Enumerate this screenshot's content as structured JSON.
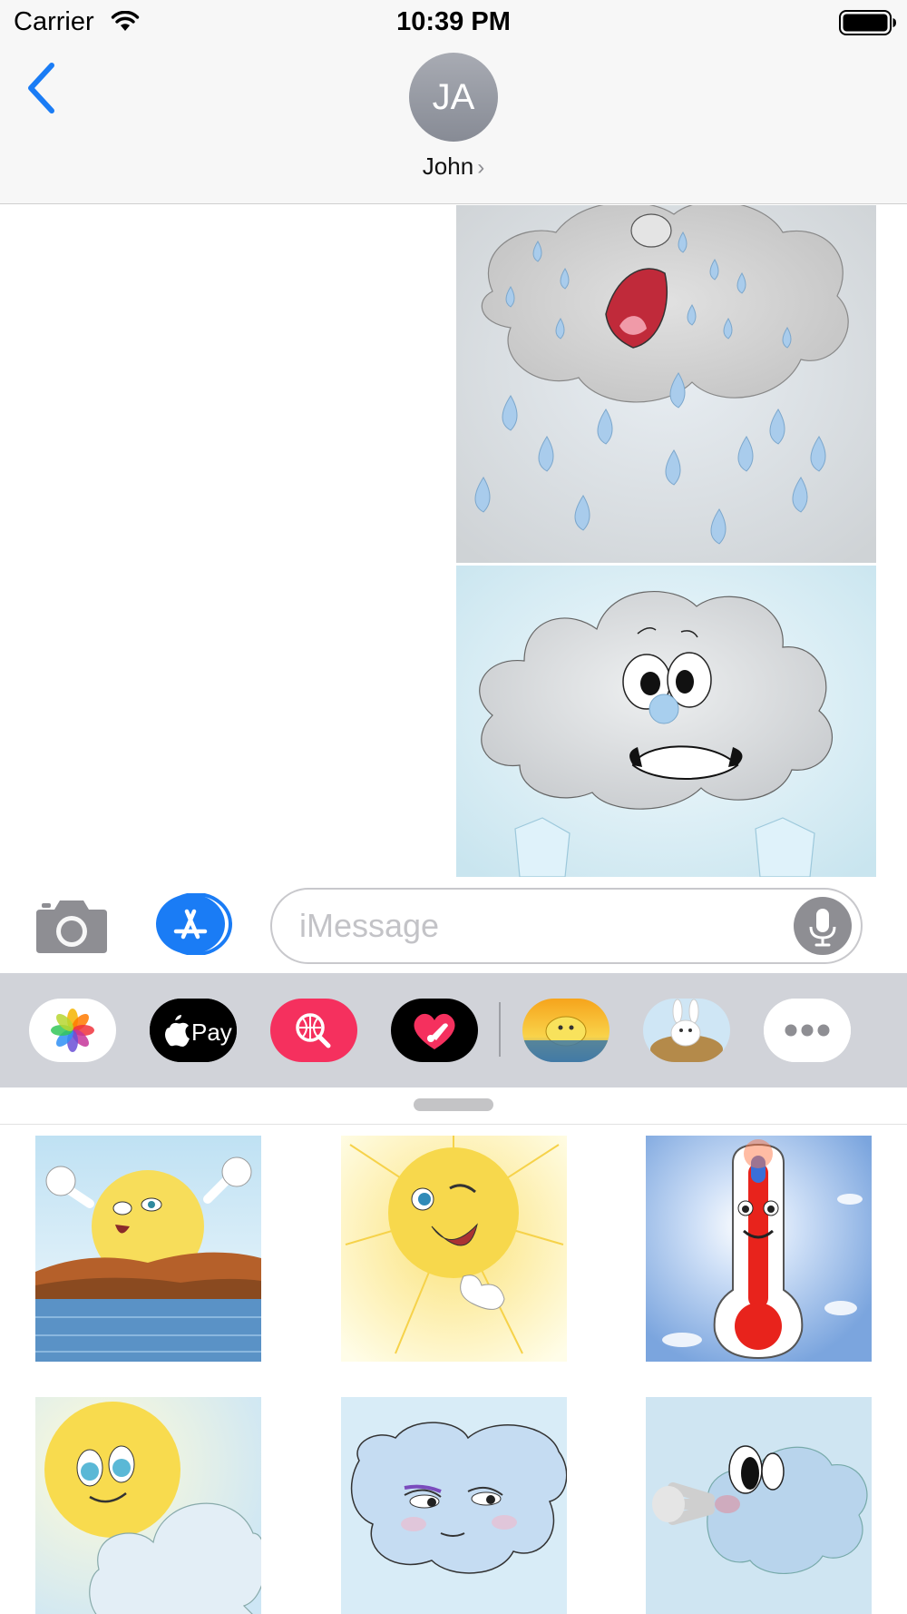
{
  "status_bar": {
    "carrier": "Carrier",
    "time": "10:39 PM",
    "wifi_icon": "wifi-icon",
    "battery_icon": "battery-full-icon"
  },
  "nav": {
    "back_icon": "chevron-left-icon",
    "avatar_initials": "JA",
    "contact_name": "John",
    "contact_chevron": "›"
  },
  "conversation": {
    "stickers": [
      {
        "name": "crying-rain-cloud-sticker",
        "icon": "crying-cloud"
      },
      {
        "name": "scared-cloud-ice-sticker",
        "icon": "scared-cloud"
      }
    ]
  },
  "input_bar": {
    "camera_icon": "camera-icon",
    "appstore_icon": "app-store-icon",
    "placeholder": "iMessage",
    "mic_icon": "microphone-icon"
  },
  "app_drawer": {
    "apps": [
      {
        "name": "Photos",
        "icon": "photos-icon"
      },
      {
        "name": "Apple Pay",
        "label": "Pay",
        "icon": "apple-pay-icon"
      },
      {
        "name": "Search",
        "icon": "web-search-icon"
      },
      {
        "name": "Digital Touch",
        "icon": "digital-touch-heart-icon"
      },
      {
        "name": "Weather stickers",
        "icon": "sun-sticker-app-icon"
      },
      {
        "name": "Bunny stickers",
        "icon": "bunny-sticker-app-icon"
      },
      {
        "name": "More",
        "icon": "more-icon"
      }
    ]
  },
  "sticker_panel": {
    "stickers": [
      {
        "name": "happy-sun-over-lake",
        "icon": "sun-lake"
      },
      {
        "name": "winking-sun-thumbs-up",
        "icon": "sun-thumbs-up"
      },
      {
        "name": "hot-thermometer",
        "icon": "thermometer"
      },
      {
        "name": "shy-sun-behind-cloud",
        "icon": "sun-cloud"
      },
      {
        "name": "sly-blue-cloud",
        "icon": "sly-cloud"
      },
      {
        "name": "blowing-wind-cloud",
        "icon": "wind-cloud"
      }
    ]
  },
  "colors": {
    "ios_blue": "#1a7cf5",
    "header_bg": "#f7f7f7",
    "drawer_bg": "#d1d3d9",
    "placeholder_gray": "#c3c3c7"
  }
}
